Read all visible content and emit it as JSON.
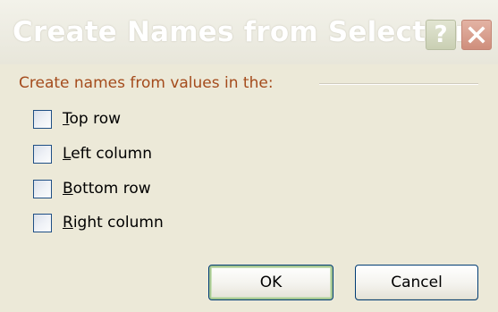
{
  "dialog": {
    "title": "Create Names from Selection",
    "help_button_glyph": "?",
    "close_button_icon": "close-x-icon"
  },
  "group": {
    "label": "Create names from values in the:"
  },
  "options": [
    {
      "accel": "T",
      "rest": "op row",
      "checked": false
    },
    {
      "accel": "L",
      "rest": "eft column",
      "checked": false
    },
    {
      "accel": "B",
      "rest": "ottom row",
      "checked": false
    },
    {
      "accel": "R",
      "rest": "ight column",
      "checked": false
    }
  ],
  "buttons": {
    "ok_label": "OK",
    "cancel_label": "Cancel"
  },
  "colors": {
    "dialog_face": "#ece9d8",
    "group_label": "#a44b1c",
    "checkbox_border": "#1f4f85",
    "button_border": "#003c74",
    "ok_focus_ring": "#a6c792",
    "close_button": "#cf8e7c"
  }
}
